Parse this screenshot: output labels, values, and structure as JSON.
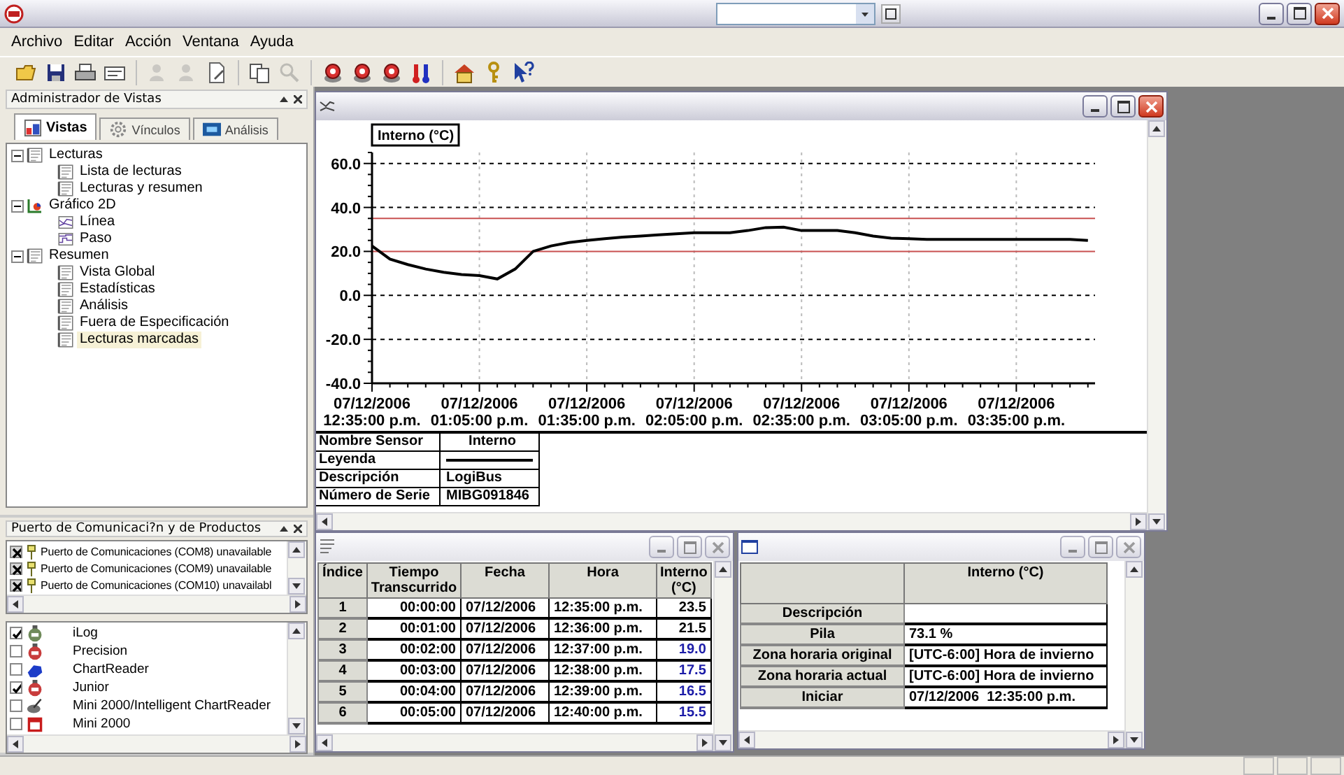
{
  "menu": [
    {
      "label": "Archivo"
    },
    {
      "label": "Editar"
    },
    {
      "label": "Acción"
    },
    {
      "label": "Ventana"
    },
    {
      "label": "Ayuda"
    }
  ],
  "toolbar": [
    [
      {
        "kind": "folder",
        "disabled": false
      },
      {
        "kind": "disk",
        "disabled": false
      },
      {
        "kind": "printer",
        "disabled": false
      },
      {
        "kind": "card",
        "disabled": false
      }
    ],
    [
      {
        "kind": "person",
        "disabled": true
      },
      {
        "kind": "person",
        "disabled": true
      },
      {
        "kind": "page",
        "disabled": false
      }
    ],
    [
      {
        "kind": "copy",
        "disabled": false
      },
      {
        "kind": "magnifier",
        "disabled": true
      }
    ],
    [
      {
        "kind": "device",
        "disabled": false
      },
      {
        "kind": "device",
        "disabled": false
      },
      {
        "kind": "device",
        "disabled": false
      },
      {
        "kind": "thermometer",
        "disabled": false
      }
    ],
    [
      {
        "kind": "home",
        "disabled": false
      },
      {
        "kind": "key",
        "disabled": false
      },
      {
        "kind": "help",
        "disabled": false
      }
    ]
  ],
  "view_manager": {
    "title": "Administrador de Vistas",
    "tabs": [
      {
        "label": "Vistas",
        "kind": "views",
        "selected": true
      },
      {
        "label": "Vínculos",
        "kind": "links",
        "selected": false
      },
      {
        "label": "Análisis",
        "kind": "analysis",
        "selected": false
      }
    ],
    "tree": [
      {
        "label": "Lecturas",
        "kind": "table",
        "expanded": true,
        "selected": false,
        "children": [
          {
            "label": "Lista de lecturas",
            "kind": "table",
            "selected": false
          },
          {
            "label": "Lecturas y resumen",
            "kind": "table",
            "selected": false
          }
        ]
      },
      {
        "label": "Gráfico 2D",
        "kind": "chart",
        "expanded": true,
        "selected": false,
        "children": [
          {
            "label": "Línea",
            "kind": "line",
            "selected": false
          },
          {
            "label": "Paso",
            "kind": "step",
            "selected": false
          }
        ]
      },
      {
        "label": "Resumen",
        "kind": "table",
        "expanded": true,
        "selected": false,
        "children": [
          {
            "label": "Vista Global",
            "kind": "table",
            "selected": false
          },
          {
            "label": "Estadísticas",
            "kind": "table",
            "selected": false
          },
          {
            "label": "Análisis",
            "kind": "table",
            "selected": false
          },
          {
            "label": "Fuera de Especificación",
            "kind": "table",
            "selected": false
          },
          {
            "label": "Lecturas marcadas",
            "kind": "table",
            "selected": true
          }
        ]
      }
    ]
  },
  "ports_panel": {
    "title": "Puerto de Comunicaci?n y de Productos",
    "ports": [
      {
        "label": "Puerto de Comunicaciones (COM8) unavailable",
        "checked": true
      },
      {
        "label": "Puerto de Comunicaciones (COM9) unavailable",
        "checked": true
      },
      {
        "label": "Puerto de Comunicaciones (COM10) unavailabl",
        "checked": true
      }
    ],
    "products": [
      {
        "label": "iLog",
        "kind": "round",
        "color": "#6f8a5a",
        "checked": true
      },
      {
        "label": "Precision",
        "kind": "round",
        "color": "#c83c3c",
        "checked": false
      },
      {
        "label": "ChartReader",
        "kind": "hand",
        "color": "#1c3cc8",
        "checked": false
      },
      {
        "label": "Junior",
        "kind": "round",
        "color": "#c83c3c",
        "checked": true
      },
      {
        "label": "Mini 2000/Intelligent ChartReader",
        "kind": "disc",
        "color": "#707070",
        "checked": false
      },
      {
        "label": "Mini 2000",
        "kind": "box",
        "color": "#c81c1c",
        "checked": false
      }
    ]
  },
  "chart_window": {
    "active": true,
    "chart_data": {
      "type": "line",
      "title": "Interno (°C)",
      "categories": [
        "07/12/2006 12:35:00 p.m.",
        null,
        null,
        null,
        null,
        null,
        "07/12/2006 01:05:00 p.m.",
        null,
        null,
        null,
        null,
        null,
        "07/12/2006 01:35:00 p.m.",
        null,
        null,
        null,
        null,
        null,
        "07/12/2006 02:05:00 p.m.",
        null,
        null,
        null,
        null,
        null,
        "07/12/2006 02:35:00 p.m.",
        null,
        null,
        null,
        null,
        null,
        "07/12/2006 03:05:00 p.m.",
        null,
        null,
        null,
        null,
        null,
        "07/12/2006 03:35:00 p.m.",
        null,
        null,
        null,
        null
      ],
      "series": [
        {
          "name": "Interno",
          "color": "#000000",
          "values": [
            22.5,
            16.5,
            14,
            12,
            10.5,
            9.5,
            9,
            7.5,
            12,
            20,
            22.5,
            24,
            25,
            25.8,
            26.5,
            27,
            27.5,
            28,
            28.5,
            28.5,
            28.5,
            29.5,
            30.8,
            31,
            29.5,
            29.5,
            29.5,
            28.5,
            27,
            26,
            25.8,
            25.5,
            25.5,
            25.5,
            25.5,
            25.5,
            25.5,
            25.5,
            25.5,
            25.5,
            25
          ]
        }
      ],
      "ylim": [
        -40,
        65
      ],
      "yticks": [
        {
          "value": -40,
          "label": "-40.0"
        },
        {
          "value": -20,
          "label": "-20.0"
        },
        {
          "value": 0,
          "label": "0.0"
        },
        {
          "value": 20,
          "label": "20.0"
        },
        {
          "value": 40,
          "label": "40.0"
        },
        {
          "value": 60,
          "label": "60.0"
        }
      ],
      "grid": true,
      "ref_lines": [
        {
          "axis": "y",
          "value": 35
        },
        {
          "axis": "y",
          "value": 20
        }
      ]
    },
    "legend": [
      {
        "kind": "series",
        "label": "Nombre Sensor"
      },
      {
        "kind": "line",
        "label": "Leyenda"
      },
      {
        "kind": "text",
        "label": "Descripción",
        "value": "LogiBus"
      },
      {
        "kind": "text",
        "label": "Número de Serie",
        "value": "MIBG091846"
      }
    ]
  },
  "readings_window": {
    "active": false,
    "columns": [
      "Índice",
      "Tiempo Transcurrido",
      "Fecha",
      "Hora",
      "Interno (°C)"
    ],
    "rows": [
      {
        "index": "1",
        "elapsed": "00:00:00",
        "date": "07/12/2006",
        "time": "12:35:00 p.m.",
        "value": "23.5",
        "out_of_range": false
      },
      {
        "index": "2",
        "elapsed": "00:01:00",
        "date": "07/12/2006",
        "time": "12:36:00 p.m.",
        "value": "21.5",
        "out_of_range": false
      },
      {
        "index": "3",
        "elapsed": "00:02:00",
        "date": "07/12/2006",
        "time": "12:37:00 p.m.",
        "value": "19.0",
        "out_of_range": true
      },
      {
        "index": "4",
        "elapsed": "00:03:00",
        "date": "07/12/2006",
        "time": "12:38:00 p.m.",
        "value": "17.5",
        "out_of_range": true
      },
      {
        "index": "5",
        "elapsed": "00:04:00",
        "date": "07/12/2006",
        "time": "12:39:00 p.m.",
        "value": "16.5",
        "out_of_range": true
      },
      {
        "index": "6",
        "elapsed": "00:05:00",
        "date": "07/12/2006",
        "time": "12:40:00 p.m.",
        "value": "15.5",
        "out_of_range": true
      }
    ]
  },
  "summary_window": {
    "active": false,
    "column": "Interno (°C)",
    "rows": [
      {
        "label": "Descripción"
      },
      {
        "label": "Pila",
        "value": "73.1 %"
      },
      {
        "label": "Zona horaria original",
        "value": "[UTC-6:00] Hora de invierno"
      },
      {
        "label": "Zona horaria actual",
        "value": "[UTC-6:00] Hora de invierno"
      },
      {
        "label": "Iniciar",
        "value": "07/12/2006  12:35:00 p.m."
      }
    ]
  }
}
